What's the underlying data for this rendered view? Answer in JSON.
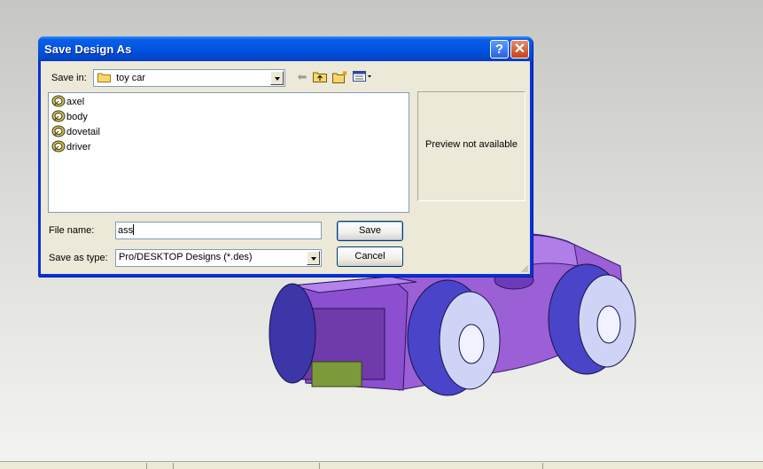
{
  "dialog": {
    "title": "Save Design As",
    "help_glyph": "?",
    "close_glyph": "✕",
    "save_in_label": "Save in:",
    "save_in_value": "toy car",
    "file_name_label": "File name:",
    "file_name_value": "ass",
    "save_as_type_label": "Save as type:",
    "save_as_type_value": "Pro/DESKTOP Designs (*.des)",
    "preview_text": "Preview not available",
    "save_button": "Save",
    "cancel_button": "Cancel",
    "files": [
      {
        "name": "axel",
        "icon": "design-file-icon"
      },
      {
        "name": "body",
        "icon": "design-file-icon"
      },
      {
        "name": "dovetail",
        "icon": "design-file-icon"
      },
      {
        "name": "driver",
        "icon": "design-file-icon"
      }
    ],
    "toolbar_icons": [
      "back-arrow-icon",
      "up-folder-icon",
      "new-folder-icon",
      "view-menu-icon"
    ]
  },
  "colors": {
    "title_bar": "#0053e1",
    "model_body": "#9b5fd6",
    "model_wheel": "#4a44c8",
    "model_accent": "#7d9a3a"
  }
}
